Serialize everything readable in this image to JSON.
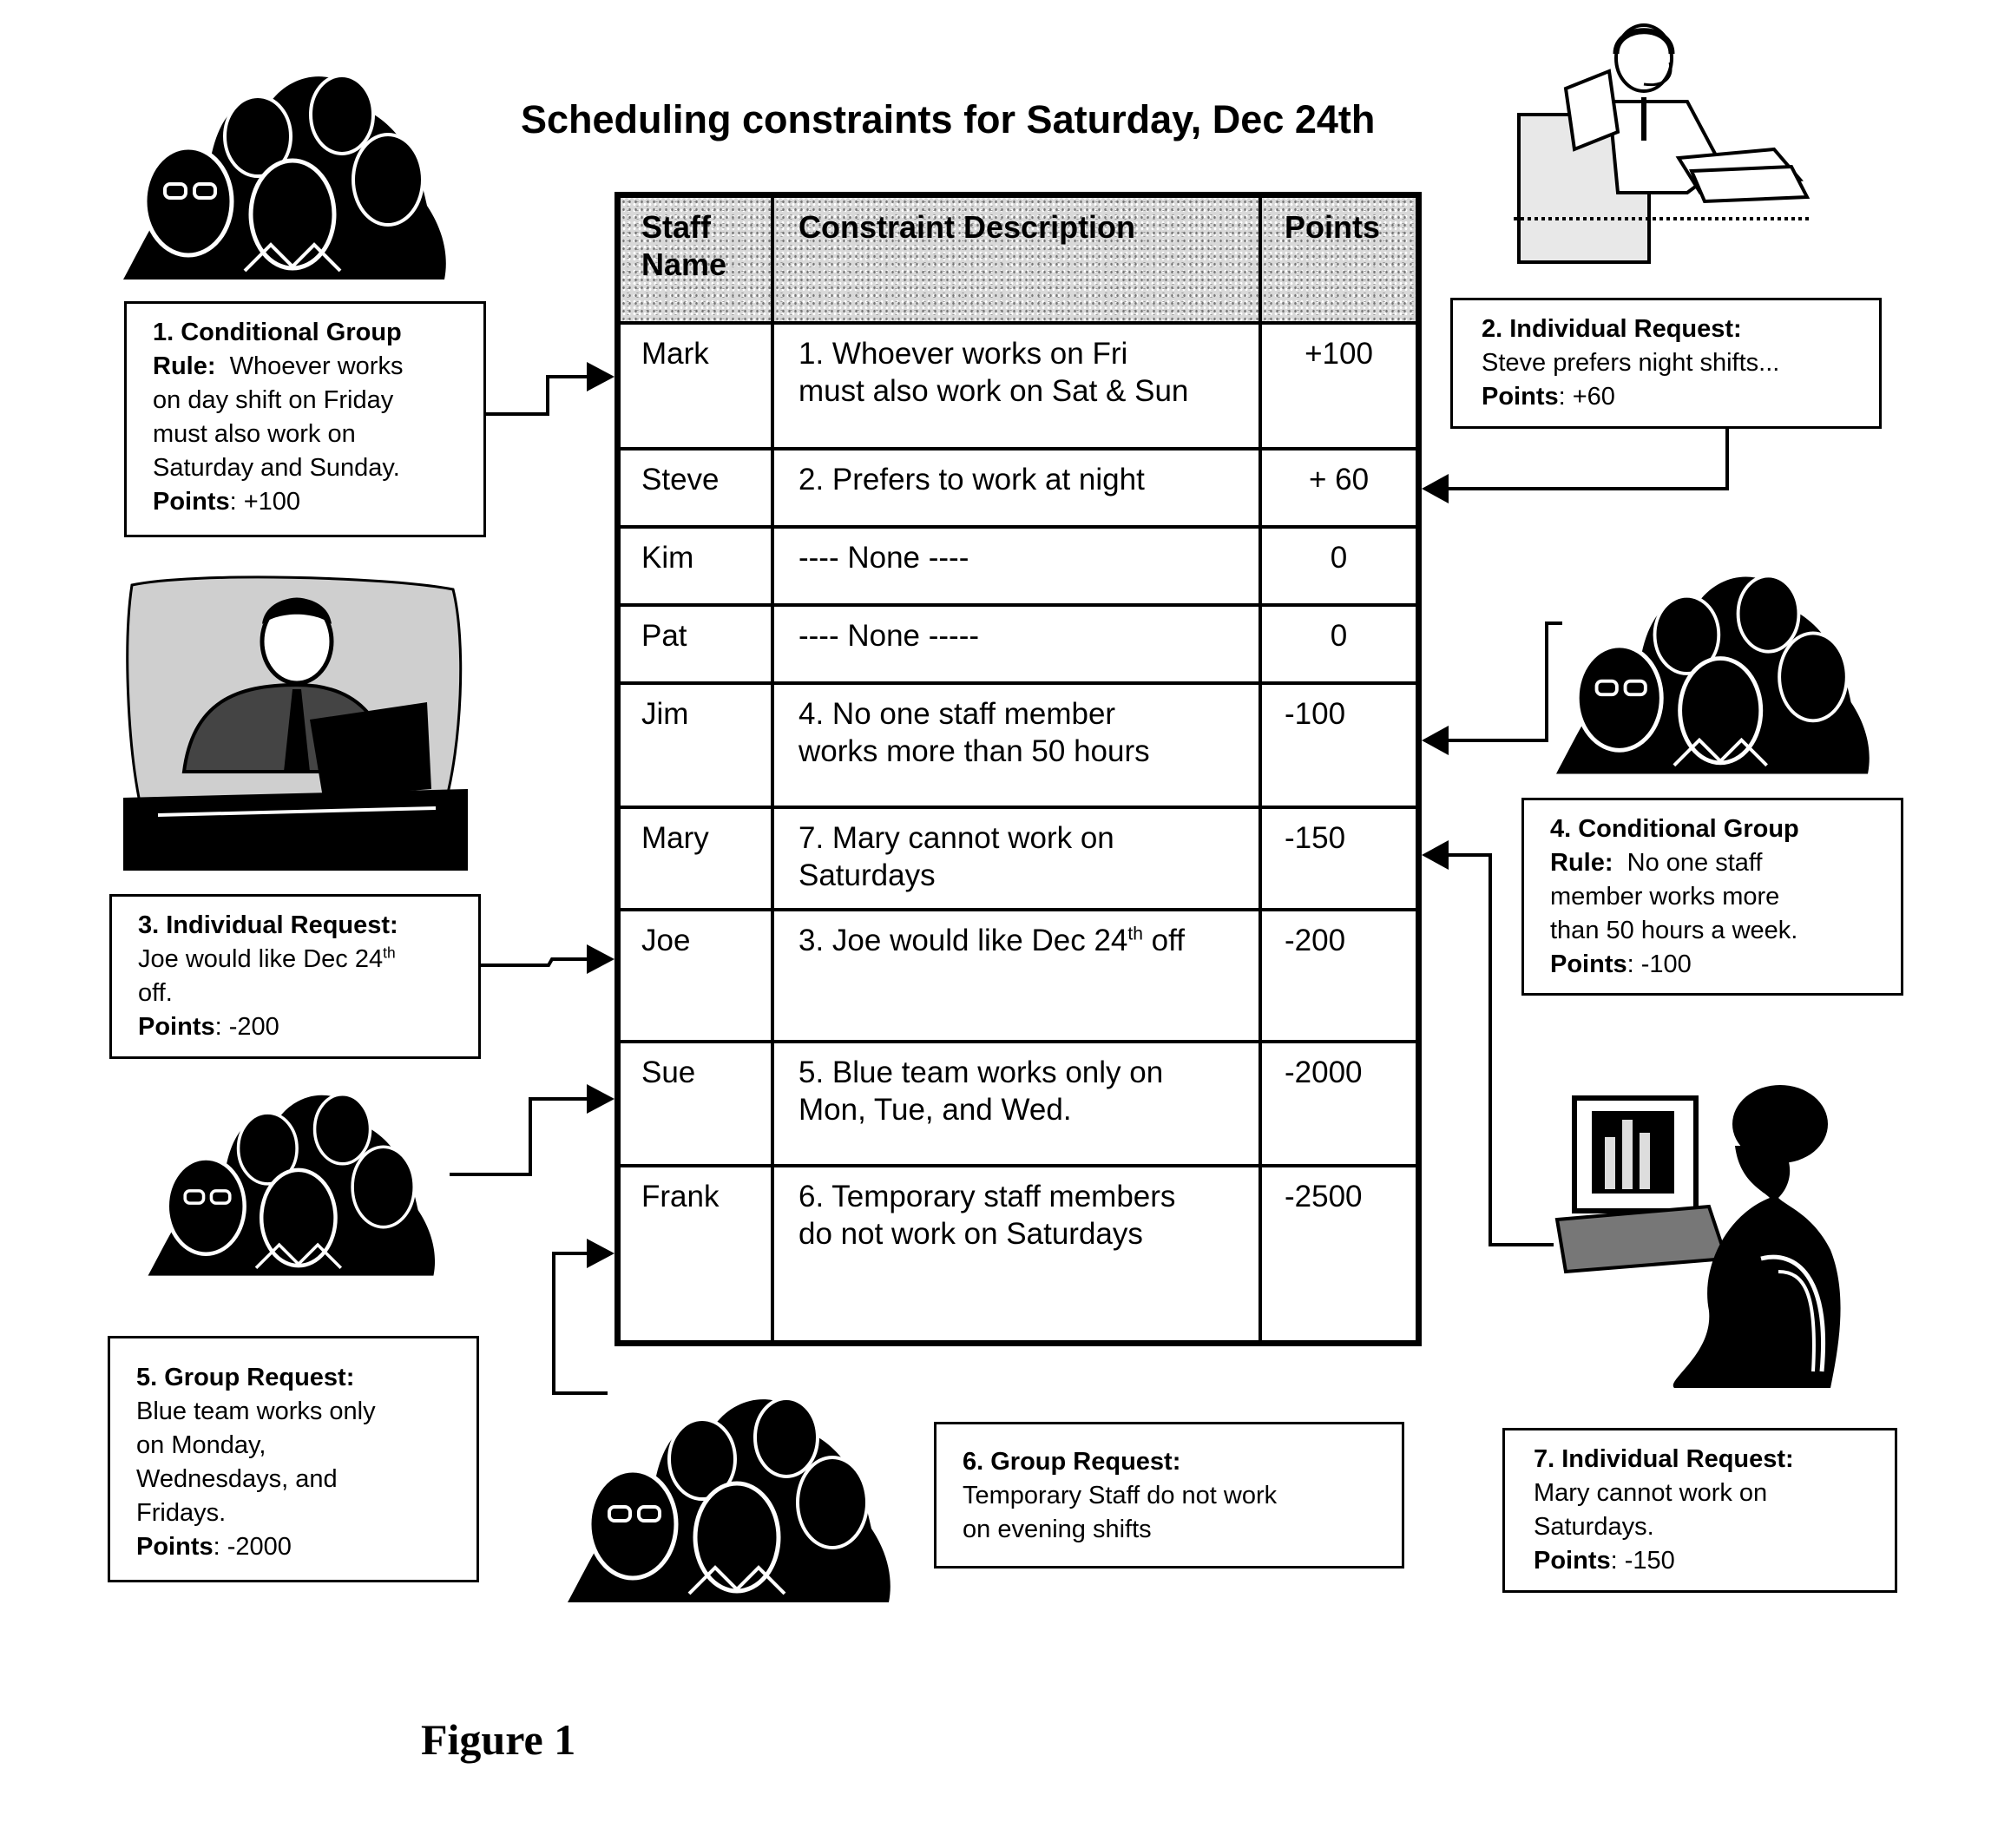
{
  "title": "Scheduling constraints for Saturday, Dec 24th",
  "figure_label": "Figure 1",
  "table": {
    "headers": {
      "staff": "Staff Name",
      "staff_line1": "Staff",
      "staff_line2": "Name",
      "description": "Constraint Description",
      "points": "Points"
    },
    "rows": [
      {
        "staff": "Mark",
        "description_line1": "1. Whoever works on Fri",
        "description_line2": "must also work on Sat & Sun",
        "points": "+100"
      },
      {
        "staff": "Steve",
        "description_line1": "2. Prefers to work at night",
        "description_line2": "",
        "points": "+ 60"
      },
      {
        "staff": "Kim",
        "description_line1": "---- None ----",
        "description_line2": "",
        "points": "0"
      },
      {
        "staff": "Pat",
        "description_line1": "---- None -----",
        "description_line2": "",
        "points": "0"
      },
      {
        "staff": "Jim",
        "description_line1": "4. No one staff member",
        "description_line2": "works more than 50 hours",
        "points": "-100"
      },
      {
        "staff": "Mary",
        "description_line1": "7. Mary cannot work on",
        "description_line2": "Saturdays",
        "points": "-150"
      },
      {
        "staff": "Joe",
        "description_line1": "3. Joe would like Dec 24",
        "description_sup": "th",
        "description_suffix": " off",
        "description_line2": "",
        "points": "-200"
      },
      {
        "staff": "Sue",
        "description_line1": "5. Blue team works only on",
        "description_line2": "Mon, Tue, and Wed.",
        "points": "-2000"
      },
      {
        "staff": "Frank",
        "description_line1": "6. Temporary staff members",
        "description_line2": "do not work on Saturdays",
        "points": "-2500"
      }
    ]
  },
  "callouts": [
    {
      "id": 1,
      "heading": "1. Conditional Group",
      "heading2": "Rule:",
      "lines": [
        "Whoever works",
        "on day shift on Friday",
        "must also work on",
        "Saturday and Sunday."
      ],
      "points_label": "Points",
      "points": ": +100",
      "target": "Mark"
    },
    {
      "id": 2,
      "heading": "2. Individual Request:",
      "lines": [
        "Steve prefers night shifts..."
      ],
      "points_label": "Points",
      "points": ": +60",
      "target": "Steve"
    },
    {
      "id": 3,
      "heading": "3. Individual Request:",
      "line1": "Joe would like Dec 24",
      "line1_sup": "th",
      "line2": "off.",
      "points_label": "Points",
      "points": ": -200",
      "target": "Joe"
    },
    {
      "id": 4,
      "heading": "4. Conditional Group",
      "heading2": "Rule:",
      "lines": [
        "No one staff",
        "member works more",
        "than 50 hours a week."
      ],
      "points_label": "Points",
      "points": ": -100",
      "target": "Jim"
    },
    {
      "id": 5,
      "heading": "5. Group Request:",
      "lines": [
        "Blue team works only",
        "on Monday,",
        "Wednesdays, and",
        "Fridays."
      ],
      "points_label": "Points",
      "points": ": -2000",
      "target": "Sue"
    },
    {
      "id": 6,
      "heading": "6. Group Request:",
      "lines": [
        "Temporary Staff do not work",
        "on evening shifts"
      ],
      "target": "Frank"
    },
    {
      "id": 7,
      "heading": "7. Individual Request:",
      "lines": [
        "Mary cannot work on",
        "Saturdays."
      ],
      "points_label": "Points",
      "points": ": -150",
      "target": "Mary"
    }
  ],
  "cliparts": [
    {
      "name": "staff-group-clipart",
      "icon": "group-of-people-icon"
    },
    {
      "name": "headset-operator-clipart",
      "icon": "man-with-headset-icon"
    },
    {
      "name": "laptop-worker-clipart",
      "icon": "man-with-laptop-icon"
    },
    {
      "name": "woman-computer-clipart",
      "icon": "woman-at-computer-icon"
    }
  ]
}
